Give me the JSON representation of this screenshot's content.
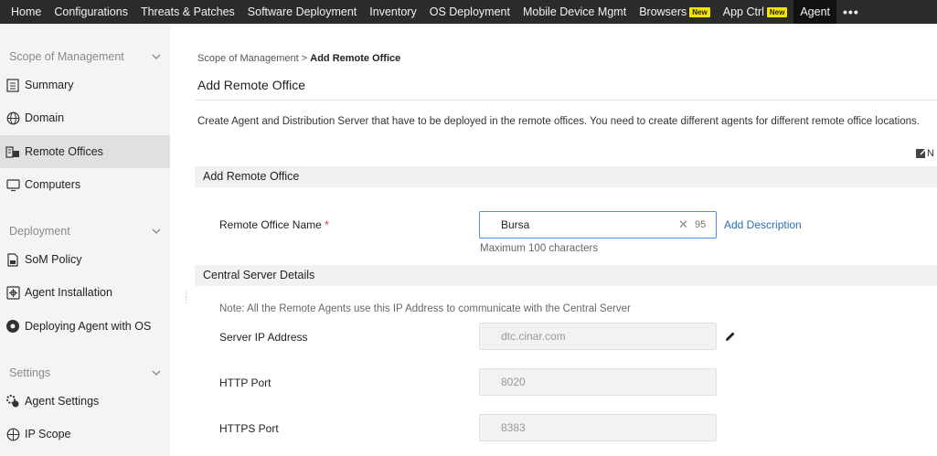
{
  "topnav": {
    "items": [
      {
        "label": "Home"
      },
      {
        "label": "Configurations"
      },
      {
        "label": "Threats & Patches"
      },
      {
        "label": "Software Deployment"
      },
      {
        "label": "Inventory"
      },
      {
        "label": "OS Deployment"
      },
      {
        "label": "Mobile Device Mgmt"
      },
      {
        "label": "Browsers",
        "badge": "New"
      },
      {
        "label": "App Ctrl",
        "badge": "New"
      },
      {
        "label": "Agent",
        "active": true
      }
    ],
    "more": "•••"
  },
  "sidebar": {
    "sections": [
      {
        "label": "Scope of Management"
      },
      {
        "label": "Deployment"
      },
      {
        "label": "Settings"
      }
    ],
    "items": [
      {
        "label": "Summary",
        "icon": "summary-icon"
      },
      {
        "label": "Domain",
        "icon": "globe-icon"
      },
      {
        "label": "Remote Offices",
        "icon": "remote-offices-icon",
        "active": true
      },
      {
        "label": "Computers",
        "icon": "computer-icon"
      },
      {
        "label": "SoM Policy",
        "icon": "policy-icon"
      },
      {
        "label": "Agent Installation",
        "icon": "agent-install-icon"
      },
      {
        "label": "Deploying Agent with OS",
        "icon": "deploy-os-icon"
      },
      {
        "label": "Agent Settings",
        "icon": "agent-settings-icon"
      },
      {
        "label": "IP Scope",
        "icon": "ip-scope-icon"
      }
    ]
  },
  "breadcrumb": {
    "parent": "Scope of Management",
    "separator": ">",
    "current": "Add Remote Office"
  },
  "page": {
    "title": "Add Remote Office",
    "description": "Create Agent and Distribution Server that have to be deployed in the remote offices. You need to create different agents for different remote office locations.",
    "note_button": "N"
  },
  "form": {
    "section1_title": "Add Remote Office",
    "office_name_label": "Remote Office Name",
    "required_mark": "*",
    "office_name_value": "Bursa",
    "office_name_remaining": "95",
    "clear_glyph": "✕",
    "add_description": "Add Description",
    "max_chars_hint": "Maximum 100 characters",
    "section2_title": "Central Server Details",
    "note": "Note: All the Remote Agents use this IP Address to communicate with the Central Server",
    "server_ip_label": "Server IP Address",
    "server_ip_value": "dtc.cinar.com",
    "http_port_label": "HTTP Port",
    "http_port_value": "8020",
    "https_port_label": "HTTPS Port",
    "https_port_value": "8383"
  },
  "colors": {
    "topnav_bg": "#2b2b2b",
    "active_nav_bg": "#111111",
    "badge_bg": "#f5e400",
    "link": "#2a6fb5",
    "focus_border": "#4a90d9"
  }
}
